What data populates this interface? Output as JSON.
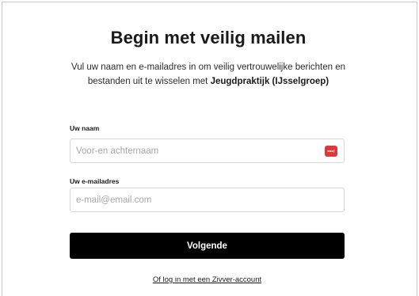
{
  "header": {
    "title": "Begin met veilig mailen"
  },
  "intro": {
    "text_before": "Vul uw naam en e-mailadres in om veilig vertrouwelijke berichten en bestanden uit te wisselen met ",
    "org_name": "Jeugdpraktijk (IJsselgroep)"
  },
  "form": {
    "name_label": "Uw naam",
    "name_placeholder": "Voor-en achternaam",
    "email_label": "Uw e-mailadres",
    "email_placeholder": "e-mail@email.com",
    "submit_label": "Volgende",
    "password_manager_icon": "password-manager-icon"
  },
  "footer": {
    "login_link": "Of log in met een Zivver-account"
  },
  "colors": {
    "button_bg": "#000000",
    "icon_bg": "#d93a3a"
  }
}
